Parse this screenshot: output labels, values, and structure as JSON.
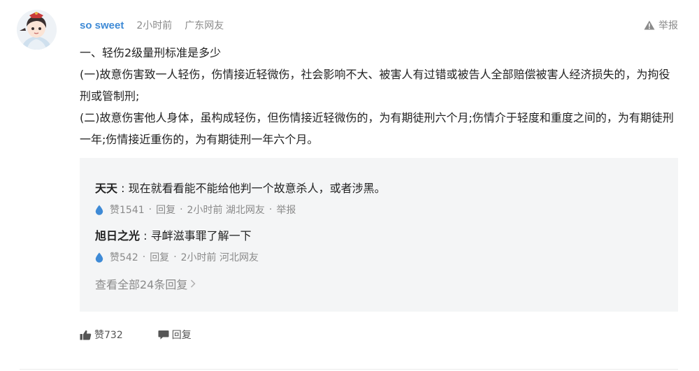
{
  "comment": {
    "username": "so sweet",
    "time": "2小时前",
    "location": "广东网友",
    "report_label": "举报",
    "paragraphs": [
      "一、轻伤2级量刑标准是多少",
      "(一)故意伤害致一人轻伤，伤情接近轻微伤，社会影响不大、被害人有过错或被告人全部赔偿被害人经济损失的，为拘役刑或管制刑;",
      "(二)故意伤害他人身体，虽构成轻伤，但伤情接近轻微伤的，为有期徒刑六个月;伤情介于轻度和重度之间的，为有期徒刑一年;伤情接近重伤的，为有期徒刑一年六个月。"
    ],
    "likes": "赞732",
    "reply_label": "回复"
  },
  "replies": [
    {
      "name": "天天",
      "colon": " : ",
      "text": "现在就看看能不能给他判一个故意杀人，或者涉黑。",
      "likes": "赞1541",
      "reply": "回复",
      "time_loc": "2小时前 湖北网友",
      "report": "举报",
      "dot": "·"
    },
    {
      "name": "旭日之光",
      "colon": " : ",
      "text": "寻衅滋事罪了解一下",
      "likes": "赞542",
      "reply": "回复",
      "time_loc": "2小时前 河北网友",
      "dot": "·"
    }
  ],
  "view_all": "查看全部24条回复",
  "colors": {
    "username": "#3e8ad6",
    "muted": "#8a8a8a",
    "reply_bg": "#f4f5f6",
    "like_drop": "#3e8ad6"
  },
  "icons": {
    "report": "warning-triangle-icon",
    "like_reply": "water-drop-icon",
    "chevron": "chevron-right-icon",
    "thumb": "thumbs-up-icon",
    "comment": "speech-bubble-icon"
  }
}
